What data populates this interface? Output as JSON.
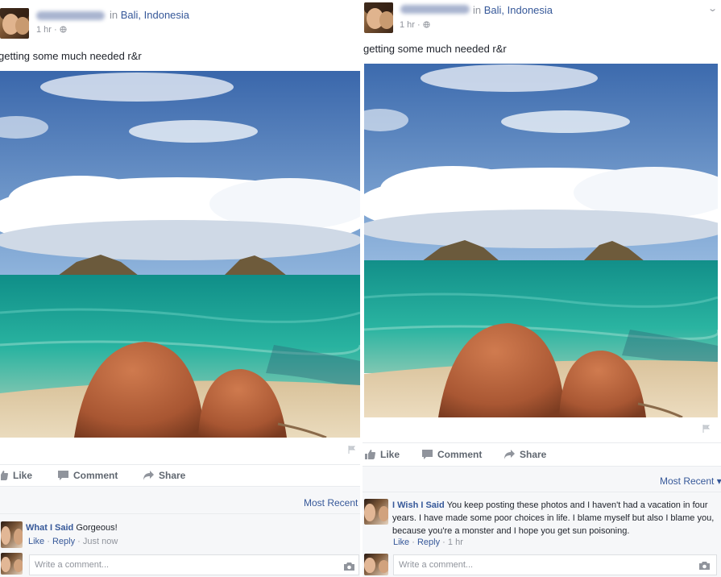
{
  "left": {
    "post": {
      "location_prefix": "in",
      "location": "Bali, Indonesia",
      "time": "1 hr ·",
      "caption": "getting some much needed r&r"
    },
    "actions": {
      "like": "Like",
      "comment": "Comment",
      "share": "Share"
    },
    "sort_label": "Most Recent",
    "comment": {
      "author": "What I Said",
      "text": "Gorgeous!",
      "like": "Like",
      "reply": "Reply",
      "time": "Just now"
    },
    "write_placeholder": "Write a comment..."
  },
  "right": {
    "post": {
      "location_prefix": "in",
      "location": "Bali, Indonesia",
      "time": "1 hr ·",
      "caption": "getting some much needed r&r"
    },
    "actions": {
      "like": "Like",
      "comment": "Comment",
      "share": "Share"
    },
    "sort_label": "Most Recent ▾",
    "comment": {
      "author": "I Wish I Said",
      "text": "You keep posting these photos and I haven't had a vacation in four years. I have made some poor choices in life. I blame myself but also I blame you, because you're a monster and I hope you get sun poisoning.",
      "like": "Like",
      "reply": "Reply",
      "time": "1 hr"
    },
    "write_placeholder": "Write a comment..."
  },
  "colors": {
    "link": "#365899",
    "meta": "#90949c",
    "sky": "#4a78b8",
    "sea": "#1fa79a",
    "sand": "#e2cba4",
    "skin": "#b9643e"
  },
  "icons": [
    "globe-icon",
    "chevron-down-icon",
    "flag-icon",
    "like-icon",
    "comment-icon",
    "share-icon",
    "camera-icon"
  ]
}
